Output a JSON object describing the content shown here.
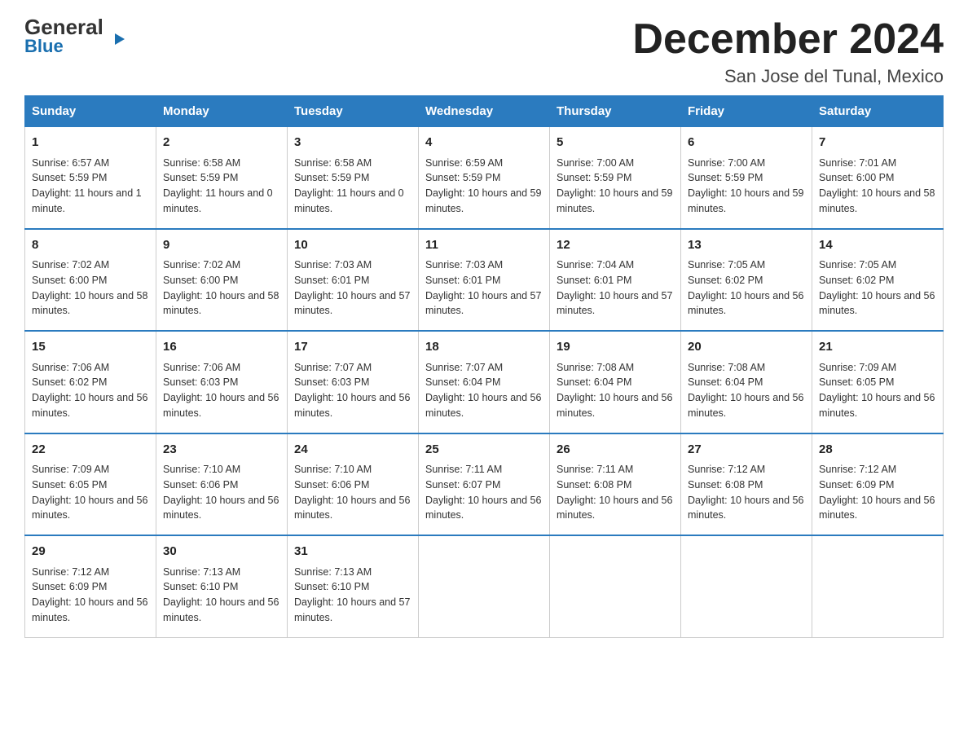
{
  "logo": {
    "line1_black": "General",
    "line1_blue_arrow": "▶",
    "line2": "Blue"
  },
  "title": "December 2024",
  "subtitle": "San Jose del Tunal, Mexico",
  "days_header": [
    "Sunday",
    "Monday",
    "Tuesday",
    "Wednesday",
    "Thursday",
    "Friday",
    "Saturday"
  ],
  "weeks": [
    [
      {
        "num": "1",
        "sunrise": "6:57 AM",
        "sunset": "5:59 PM",
        "daylight": "11 hours and 1 minute."
      },
      {
        "num": "2",
        "sunrise": "6:58 AM",
        "sunset": "5:59 PM",
        "daylight": "11 hours and 0 minutes."
      },
      {
        "num": "3",
        "sunrise": "6:58 AM",
        "sunset": "5:59 PM",
        "daylight": "11 hours and 0 minutes."
      },
      {
        "num": "4",
        "sunrise": "6:59 AM",
        "sunset": "5:59 PM",
        "daylight": "10 hours and 59 minutes."
      },
      {
        "num": "5",
        "sunrise": "7:00 AM",
        "sunset": "5:59 PM",
        "daylight": "10 hours and 59 minutes."
      },
      {
        "num": "6",
        "sunrise": "7:00 AM",
        "sunset": "5:59 PM",
        "daylight": "10 hours and 59 minutes."
      },
      {
        "num": "7",
        "sunrise": "7:01 AM",
        "sunset": "6:00 PM",
        "daylight": "10 hours and 58 minutes."
      }
    ],
    [
      {
        "num": "8",
        "sunrise": "7:02 AM",
        "sunset": "6:00 PM",
        "daylight": "10 hours and 58 minutes."
      },
      {
        "num": "9",
        "sunrise": "7:02 AM",
        "sunset": "6:00 PM",
        "daylight": "10 hours and 58 minutes."
      },
      {
        "num": "10",
        "sunrise": "7:03 AM",
        "sunset": "6:01 PM",
        "daylight": "10 hours and 57 minutes."
      },
      {
        "num": "11",
        "sunrise": "7:03 AM",
        "sunset": "6:01 PM",
        "daylight": "10 hours and 57 minutes."
      },
      {
        "num": "12",
        "sunrise": "7:04 AM",
        "sunset": "6:01 PM",
        "daylight": "10 hours and 57 minutes."
      },
      {
        "num": "13",
        "sunrise": "7:05 AM",
        "sunset": "6:02 PM",
        "daylight": "10 hours and 56 minutes."
      },
      {
        "num": "14",
        "sunrise": "7:05 AM",
        "sunset": "6:02 PM",
        "daylight": "10 hours and 56 minutes."
      }
    ],
    [
      {
        "num": "15",
        "sunrise": "7:06 AM",
        "sunset": "6:02 PM",
        "daylight": "10 hours and 56 minutes."
      },
      {
        "num": "16",
        "sunrise": "7:06 AM",
        "sunset": "6:03 PM",
        "daylight": "10 hours and 56 minutes."
      },
      {
        "num": "17",
        "sunrise": "7:07 AM",
        "sunset": "6:03 PM",
        "daylight": "10 hours and 56 minutes."
      },
      {
        "num": "18",
        "sunrise": "7:07 AM",
        "sunset": "6:04 PM",
        "daylight": "10 hours and 56 minutes."
      },
      {
        "num": "19",
        "sunrise": "7:08 AM",
        "sunset": "6:04 PM",
        "daylight": "10 hours and 56 minutes."
      },
      {
        "num": "20",
        "sunrise": "7:08 AM",
        "sunset": "6:04 PM",
        "daylight": "10 hours and 56 minutes."
      },
      {
        "num": "21",
        "sunrise": "7:09 AM",
        "sunset": "6:05 PM",
        "daylight": "10 hours and 56 minutes."
      }
    ],
    [
      {
        "num": "22",
        "sunrise": "7:09 AM",
        "sunset": "6:05 PM",
        "daylight": "10 hours and 56 minutes."
      },
      {
        "num": "23",
        "sunrise": "7:10 AM",
        "sunset": "6:06 PM",
        "daylight": "10 hours and 56 minutes."
      },
      {
        "num": "24",
        "sunrise": "7:10 AM",
        "sunset": "6:06 PM",
        "daylight": "10 hours and 56 minutes."
      },
      {
        "num": "25",
        "sunrise": "7:11 AM",
        "sunset": "6:07 PM",
        "daylight": "10 hours and 56 minutes."
      },
      {
        "num": "26",
        "sunrise": "7:11 AM",
        "sunset": "6:08 PM",
        "daylight": "10 hours and 56 minutes."
      },
      {
        "num": "27",
        "sunrise": "7:12 AM",
        "sunset": "6:08 PM",
        "daylight": "10 hours and 56 minutes."
      },
      {
        "num": "28",
        "sunrise": "7:12 AM",
        "sunset": "6:09 PM",
        "daylight": "10 hours and 56 minutes."
      }
    ],
    [
      {
        "num": "29",
        "sunrise": "7:12 AM",
        "sunset": "6:09 PM",
        "daylight": "10 hours and 56 minutes."
      },
      {
        "num": "30",
        "sunrise": "7:13 AM",
        "sunset": "6:10 PM",
        "daylight": "10 hours and 56 minutes."
      },
      {
        "num": "31",
        "sunrise": "7:13 AM",
        "sunset": "6:10 PM",
        "daylight": "10 hours and 57 minutes."
      },
      null,
      null,
      null,
      null
    ]
  ]
}
